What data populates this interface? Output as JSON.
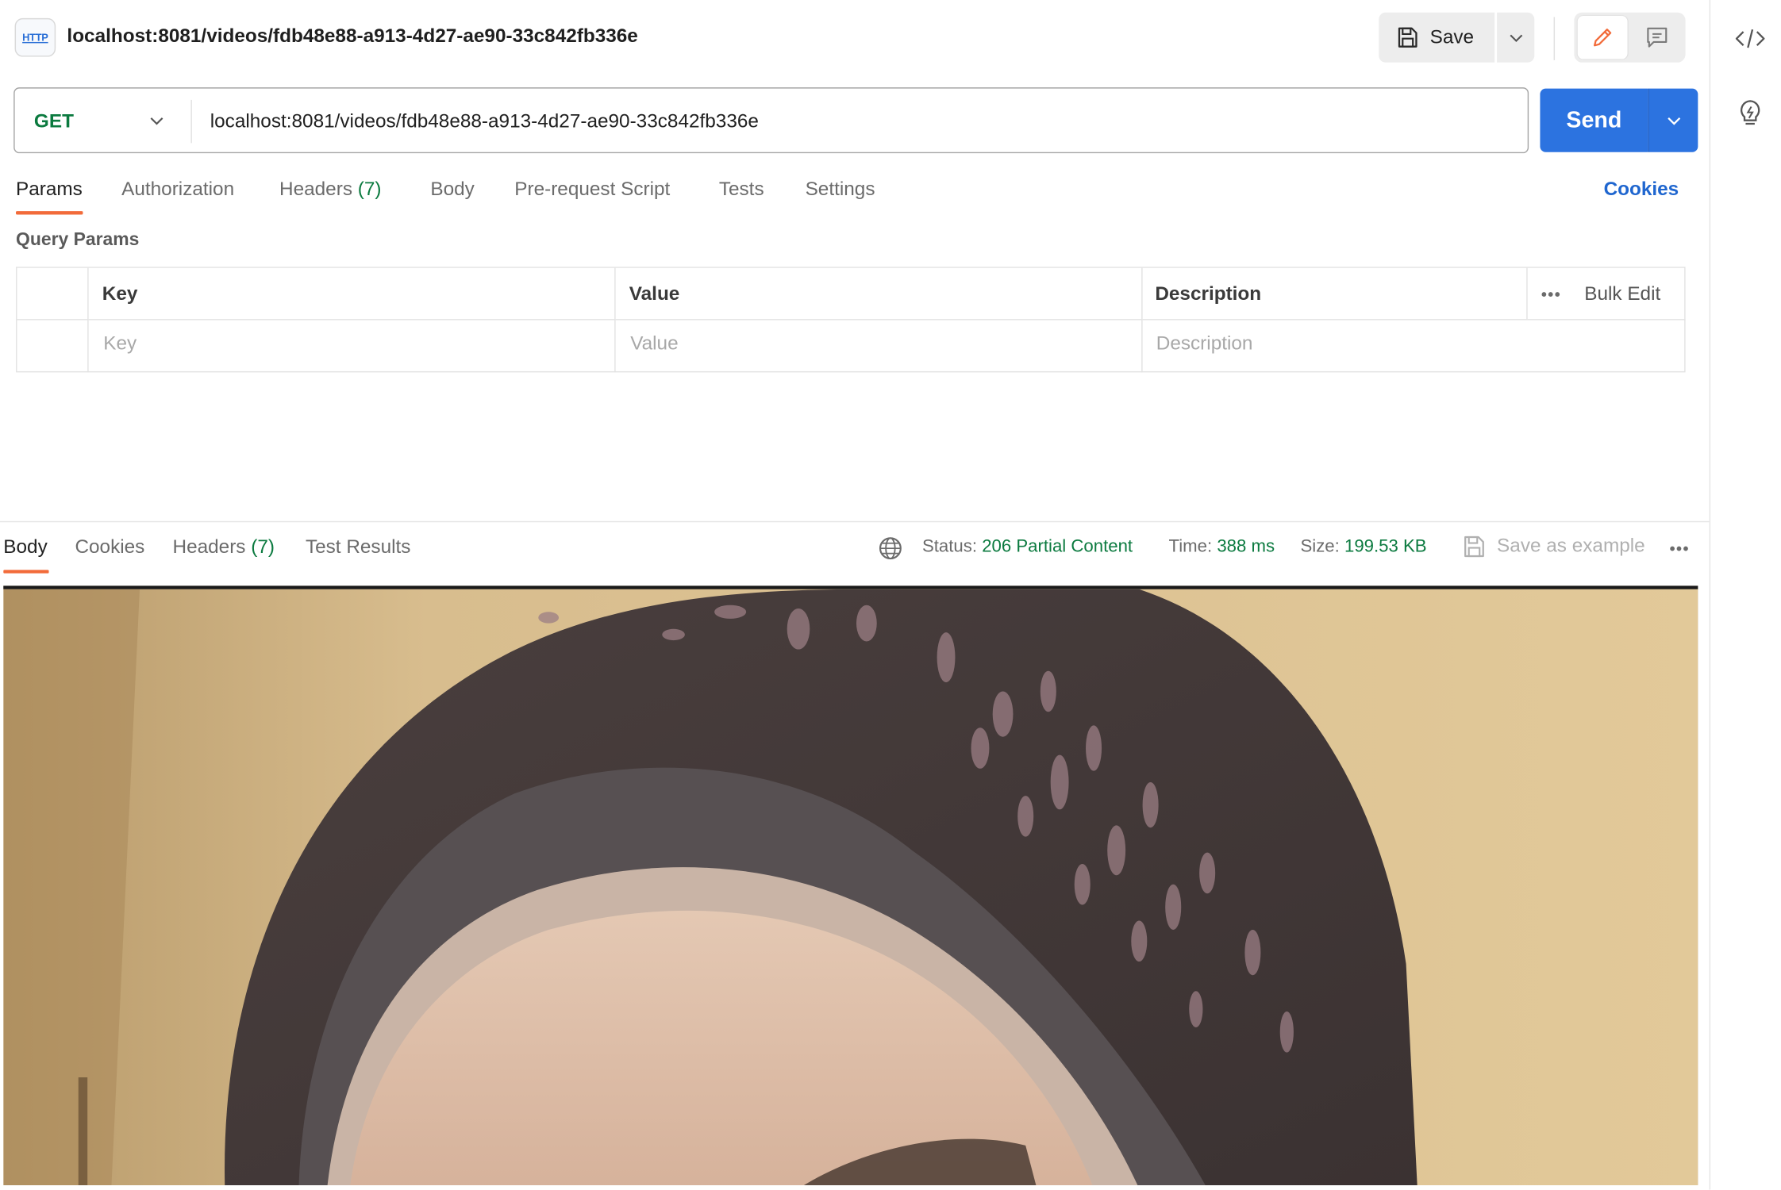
{
  "request": {
    "badge": "HTTP",
    "title": "localhost:8081/videos/fdb48e88-a913-4d27-ae90-33c842fb336e",
    "save_label": "Save",
    "method": "GET",
    "url": "localhost:8081/videos/fdb48e88-a913-4d27-ae90-33c842fb336e",
    "send_label": "Send"
  },
  "request_tabs": {
    "params": "Params",
    "authorization": "Authorization",
    "headers": "Headers",
    "headers_count": "(7)",
    "body": "Body",
    "prerequest": "Pre-request Script",
    "tests": "Tests",
    "settings": "Settings",
    "cookies": "Cookies"
  },
  "query_params": {
    "title": "Query Params",
    "columns": {
      "key": "Key",
      "value": "Value",
      "description": "Description"
    },
    "placeholders": {
      "key": "Key",
      "value": "Value",
      "description": "Description"
    },
    "more": "•••",
    "bulk_edit": "Bulk Edit"
  },
  "response_tabs": {
    "body": "Body",
    "cookies": "Cookies",
    "headers": "Headers",
    "headers_count": "(7)",
    "test_results": "Test Results"
  },
  "response_status": {
    "status_label": "Status:",
    "status_value": "206 Partial Content",
    "time_label": "Time:",
    "time_value": "388 ms",
    "size_label": "Size:",
    "size_value": "199.53 KB",
    "save_example": "Save as example",
    "more": "•••"
  },
  "colors": {
    "accent_send": "#2c73e0",
    "active_tab": "#f26b3a",
    "success_green": "#0b7a3f",
    "link_blue": "#1f66cf"
  },
  "icons": {
    "save": "floppy-disk-icon",
    "edit": "pencil-icon",
    "comment": "comment-icon",
    "globe": "globe-icon",
    "code": "code-icon",
    "lightbulb": "lightbulb-icon"
  }
}
